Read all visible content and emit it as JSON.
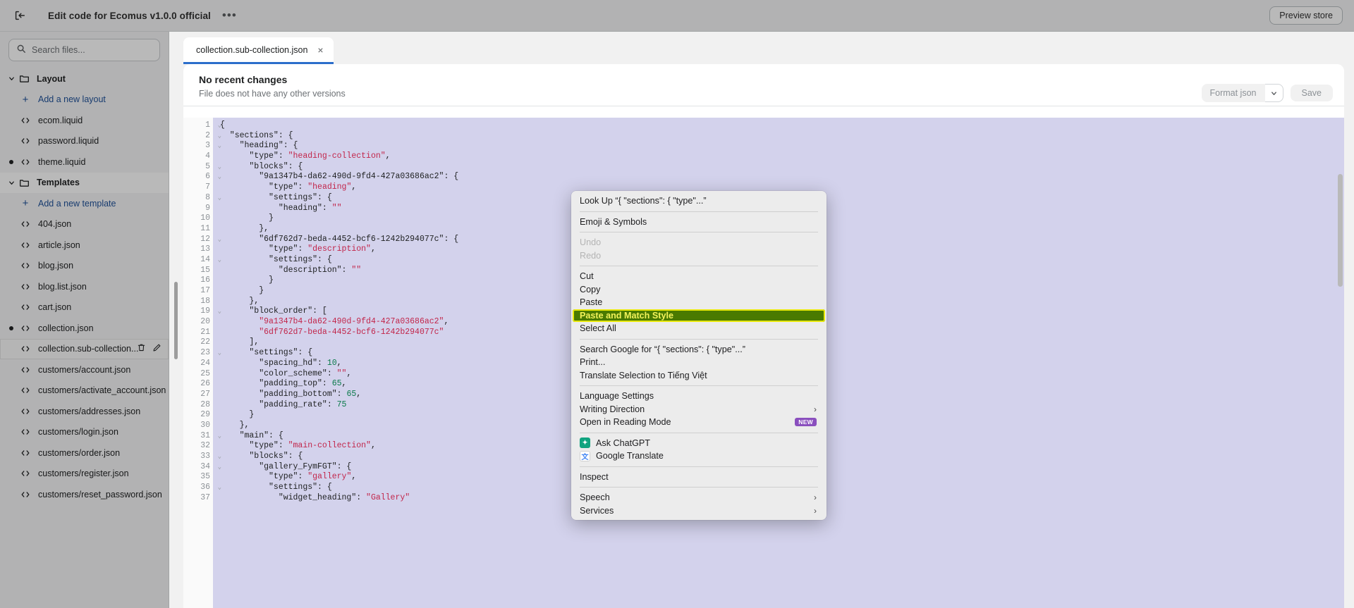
{
  "topbar": {
    "exit_icon": "exit-icon",
    "title": "Edit code for Ecomus v1.0.0 official",
    "more_label": "•••",
    "preview_label": "Preview store"
  },
  "sidebar": {
    "search": {
      "placeholder": "Search files...",
      "icon": "search-icon"
    },
    "tree": [
      {
        "kind": "folder",
        "label": "Layout",
        "icon": "folder-icon",
        "chev": "▾",
        "dot": false,
        "state": "normal"
      },
      {
        "kind": "add",
        "label": "Add a new layout",
        "icon": "plus-icon",
        "dot": false,
        "state": "normal"
      },
      {
        "kind": "file",
        "label": "ecom.liquid",
        "icon": "code-icon",
        "dot": false,
        "state": "normal"
      },
      {
        "kind": "file",
        "label": "password.liquid",
        "icon": "code-icon",
        "dot": false,
        "state": "normal"
      },
      {
        "kind": "file",
        "label": "theme.liquid",
        "icon": "code-icon",
        "dot": true,
        "state": "normal"
      },
      {
        "kind": "folder",
        "label": "Templates",
        "icon": "folder-icon",
        "chev": "▾",
        "dot": false,
        "state": "highlight"
      },
      {
        "kind": "add",
        "label": "Add a new template",
        "icon": "plus-icon",
        "dot": false,
        "state": "normal"
      },
      {
        "kind": "file",
        "label": "404.json",
        "icon": "code-icon",
        "dot": false,
        "state": "normal"
      },
      {
        "kind": "file",
        "label": "article.json",
        "icon": "code-icon",
        "dot": false,
        "state": "normal"
      },
      {
        "kind": "file",
        "label": "blog.json",
        "icon": "code-icon",
        "dot": false,
        "state": "normal"
      },
      {
        "kind": "file",
        "label": "blog.list.json",
        "icon": "code-icon",
        "dot": false,
        "state": "normal"
      },
      {
        "kind": "file",
        "label": "cart.json",
        "icon": "code-icon",
        "dot": false,
        "state": "normal"
      },
      {
        "kind": "file",
        "label": "collection.json",
        "icon": "code-icon",
        "dot": true,
        "state": "normal"
      },
      {
        "kind": "file",
        "label": "collection.sub-collection...",
        "icon": "code-icon",
        "dot": false,
        "state": "selected",
        "actions": [
          "trash-icon",
          "pencil-icon"
        ]
      },
      {
        "kind": "file",
        "label": "customers/account.json",
        "icon": "code-icon",
        "dot": false,
        "state": "normal"
      },
      {
        "kind": "file",
        "label": "customers/activate_account.json",
        "icon": "code-icon",
        "dot": false,
        "state": "normal"
      },
      {
        "kind": "file",
        "label": "customers/addresses.json",
        "icon": "code-icon",
        "dot": false,
        "state": "normal"
      },
      {
        "kind": "file",
        "label": "customers/login.json",
        "icon": "code-icon",
        "dot": false,
        "state": "normal"
      },
      {
        "kind": "file",
        "label": "customers/order.json",
        "icon": "code-icon",
        "dot": false,
        "state": "normal"
      },
      {
        "kind": "file",
        "label": "customers/register.json",
        "icon": "code-icon",
        "dot": false,
        "state": "normal"
      },
      {
        "kind": "file",
        "label": "customers/reset_password.json",
        "icon": "code-icon",
        "dot": false,
        "state": "normal"
      }
    ]
  },
  "editor": {
    "tab_label": "collection.sub-collection.json",
    "tab_close": "×",
    "no_changes_title": "No recent changes",
    "no_changes_sub": "File does not have any other versions",
    "format_label": "Format json",
    "format_caret": "⌄",
    "save_label": "Save",
    "lines": [
      {
        "n": 1,
        "fold": true,
        "text": "{"
      },
      {
        "n": 2,
        "fold": true,
        "text": "  \"sections\": {"
      },
      {
        "n": 3,
        "fold": true,
        "text": "    \"heading\": {"
      },
      {
        "n": 4,
        "fold": false,
        "text": "      \"type\": @\"heading-collection\"@,"
      },
      {
        "n": 5,
        "fold": true,
        "text": "      \"blocks\": {"
      },
      {
        "n": 6,
        "fold": true,
        "text": "        \"9a1347b4-da62-490d-9fd4-427a03686ac2\": {"
      },
      {
        "n": 7,
        "fold": false,
        "text": "          \"type\": @\"heading\"@,"
      },
      {
        "n": 8,
        "fold": true,
        "text": "          \"settings\": {"
      },
      {
        "n": 9,
        "fold": false,
        "text": "            \"heading\": @\"\"@"
      },
      {
        "n": 10,
        "fold": false,
        "text": "          }"
      },
      {
        "n": 11,
        "fold": false,
        "text": "        },"
      },
      {
        "n": 12,
        "fold": true,
        "text": "        \"6df762d7-beda-4452-bcf6-1242b294077c\": {"
      },
      {
        "n": 13,
        "fold": false,
        "text": "          \"type\": @\"description\"@,"
      },
      {
        "n": 14,
        "fold": true,
        "text": "          \"settings\": {"
      },
      {
        "n": 15,
        "fold": false,
        "text": "            \"description\": @\"\"@"
      },
      {
        "n": 16,
        "fold": false,
        "text": "          }"
      },
      {
        "n": 17,
        "fold": false,
        "text": "        }"
      },
      {
        "n": 18,
        "fold": false,
        "text": "      },"
      },
      {
        "n": 19,
        "fold": true,
        "text": "      \"block_order\": ["
      },
      {
        "n": 20,
        "fold": false,
        "text": "        @\"9a1347b4-da62-490d-9fd4-427a03686ac2\"@,"
      },
      {
        "n": 21,
        "fold": false,
        "text": "        @\"6df762d7-beda-4452-bcf6-1242b294077c\"@"
      },
      {
        "n": 22,
        "fold": false,
        "text": "      ],"
      },
      {
        "n": 23,
        "fold": true,
        "text": "      \"settings\": {"
      },
      {
        "n": 24,
        "fold": false,
        "text": "        \"spacing_hd\": #10#,"
      },
      {
        "n": 25,
        "fold": false,
        "text": "        \"color_scheme\": @\"\"@,"
      },
      {
        "n": 26,
        "fold": false,
        "text": "        \"padding_top\": #65#,"
      },
      {
        "n": 27,
        "fold": false,
        "text": "        \"padding_bottom\": #65#,"
      },
      {
        "n": 28,
        "fold": false,
        "text": "        \"padding_rate\": #75#"
      },
      {
        "n": 29,
        "fold": false,
        "text": "      }"
      },
      {
        "n": 30,
        "fold": false,
        "text": "    },"
      },
      {
        "n": 31,
        "fold": true,
        "text": "    \"main\": {"
      },
      {
        "n": 32,
        "fold": false,
        "text": "      \"type\": @\"main-collection\"@,"
      },
      {
        "n": 33,
        "fold": true,
        "text": "      \"blocks\": {"
      },
      {
        "n": 34,
        "fold": true,
        "text": "        \"gallery_FymFGT\": {"
      },
      {
        "n": 35,
        "fold": false,
        "text": "          \"type\": @\"gallery\"@,"
      },
      {
        "n": 36,
        "fold": true,
        "text": "          \"settings\": {"
      },
      {
        "n": 37,
        "fold": false,
        "text": "            \"widget_heading\": @\"Gallery\"@"
      }
    ]
  },
  "context_menu": {
    "items": [
      {
        "type": "item",
        "label": "Look Up “{   \"sections\": {    \"type\"...”",
        "state": "normal",
        "icon": null
      },
      {
        "type": "sep"
      },
      {
        "type": "item",
        "label": "Emoji & Symbols",
        "state": "normal",
        "icon": null
      },
      {
        "type": "sep"
      },
      {
        "type": "item",
        "label": "Undo",
        "state": "disabled",
        "icon": null
      },
      {
        "type": "item",
        "label": "Redo",
        "state": "disabled",
        "icon": null
      },
      {
        "type": "sep"
      },
      {
        "type": "item",
        "label": "Cut",
        "state": "normal",
        "icon": null
      },
      {
        "type": "item",
        "label": "Copy",
        "state": "normal",
        "icon": null
      },
      {
        "type": "item",
        "label": "Paste",
        "state": "normal",
        "icon": null
      },
      {
        "type": "item",
        "label": "Paste and Match Style",
        "state": "highlighted",
        "icon": null
      },
      {
        "type": "item",
        "label": "Select All",
        "state": "normal",
        "icon": null
      },
      {
        "type": "sep"
      },
      {
        "type": "item",
        "label": "Search Google for “{   \"sections\": {    \"type\"...”",
        "state": "normal",
        "icon": null
      },
      {
        "type": "item",
        "label": "Print...",
        "state": "normal",
        "icon": null
      },
      {
        "type": "item",
        "label": "Translate Selection to Tiếng Việt",
        "state": "normal",
        "icon": null
      },
      {
        "type": "sep"
      },
      {
        "type": "item",
        "label": "Language Settings",
        "state": "normal",
        "icon": null
      },
      {
        "type": "item",
        "label": "Writing Direction",
        "state": "normal",
        "icon": null,
        "submenu": "›"
      },
      {
        "type": "item",
        "label": "Open in Reading Mode",
        "state": "normal",
        "icon": null,
        "badge": "NEW"
      },
      {
        "type": "sep"
      },
      {
        "type": "item",
        "label": "Ask ChatGPT",
        "state": "normal",
        "icon": "chatgpt-icon"
      },
      {
        "type": "item",
        "label": "Google Translate",
        "state": "normal",
        "icon": "google-translate-icon"
      },
      {
        "type": "sep"
      },
      {
        "type": "item",
        "label": "Inspect",
        "state": "normal",
        "icon": null
      },
      {
        "type": "sep"
      },
      {
        "type": "item",
        "label": "Speech",
        "state": "normal",
        "icon": null,
        "submenu": "›"
      },
      {
        "type": "item",
        "label": "Services",
        "state": "normal",
        "icon": null,
        "submenu": "›"
      }
    ]
  },
  "colors": {
    "accent": "#2c6ecb",
    "link": "#1f5199",
    "selection": "#d3d2ec",
    "string": "#c2254a",
    "number": "#0a7a4a",
    "highlight_bg": "#4a7a00",
    "highlight_fg": "#f2f25a",
    "highlight_outline": "#e8e80c",
    "badge_new": "#8a4fbe"
  }
}
